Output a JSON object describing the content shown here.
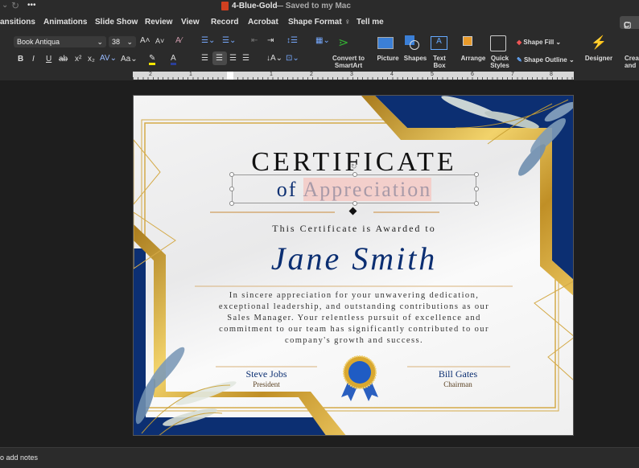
{
  "titlebar": {
    "doc_title": "4-Blue-Gold",
    "save_status": "— Saved to my Mac",
    "more": "•••"
  },
  "menu": [
    "ansitions",
    "Animations",
    "Slide Show",
    "Review",
    "View",
    "Record",
    "Acrobat",
    "Shape Format",
    "Tell me"
  ],
  "comments_label": "C",
  "ribbon": {
    "font_name": "Book Antiqua",
    "font_size": "38",
    "convert_smartart": [
      "Convert to",
      "SmartArt"
    ],
    "picture": "Picture",
    "shapes": "Shapes",
    "text_box": [
      "Text",
      "Box"
    ],
    "arrange": "Arrange",
    "quick_styles": [
      "Quick",
      "Styles"
    ],
    "shape_fill": "Shape Fill",
    "shape_outline": "Shape Outline",
    "designer": "Designer",
    "create": [
      "Crea",
      "and s"
    ],
    "highlight_color": "#f5e500",
    "font_color": "#2a3f9a"
  },
  "ruler": {
    "labels": [
      "2",
      "1",
      "1",
      "2",
      "3",
      "4",
      "5",
      "6",
      "7",
      "8"
    ]
  },
  "certificate": {
    "title": "CERTIFICATE",
    "subtitle_of": "of",
    "subtitle_main": "Appreciation",
    "awarded_to": "This Certificate is Awarded to",
    "recipient": "Jane Smith",
    "body": [
      "In sincere appreciation for your unwavering dedication,",
      "exceptional leadership, and outstanding contributions as our",
      "Sales Manager. Your relentless pursuit of excellence and",
      "commitment to our team has significantly contributed to our",
      "company's growth and success."
    ],
    "signers": [
      {
        "name": "Steve Jobs",
        "role": "President"
      },
      {
        "name": "Bill Gates",
        "role": "Chairman"
      }
    ],
    "colors": {
      "navy": "#0c2f72",
      "gold": "#c9a032",
      "highlight": "#f3cfcb"
    }
  },
  "notes": {
    "placeholder": "o add notes"
  }
}
